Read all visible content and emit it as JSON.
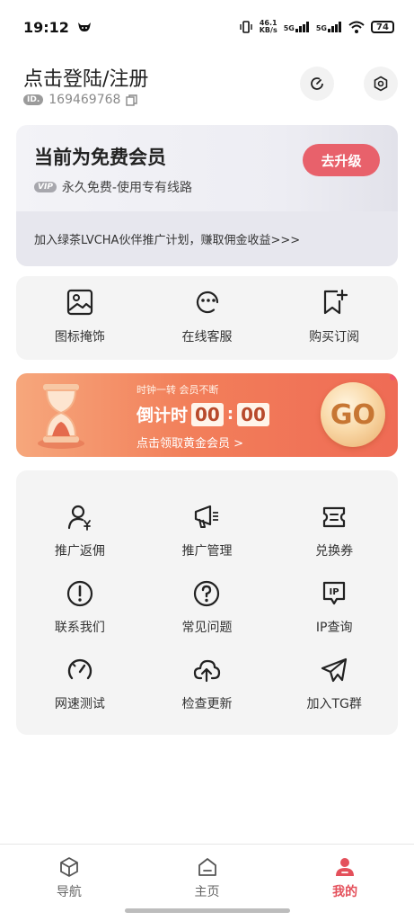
{
  "status_bar": {
    "time": "19:12",
    "net_speed_value": "46.1",
    "net_speed_unit": "KB/s",
    "sig1": "5G",
    "sig2": "5G",
    "battery": "74"
  },
  "header": {
    "login_text": "点击登陆/注册",
    "id_badge": "ID.",
    "user_id": "169469768",
    "icons": [
      "speed-test-icon",
      "settings-icon"
    ]
  },
  "membership": {
    "title": "当前为免费会员",
    "vip_tag": "VIP",
    "subtitle": "永久免费-使用专有线路",
    "upgrade_label": "去升级",
    "promo_text": "加入绿茶LVCHA伙伴推广计划，赚取佣金收益>>>"
  },
  "quick_actions": [
    {
      "label": "图标掩饰",
      "icon": "image-icon"
    },
    {
      "label": "在线客服",
      "icon": "chat-face-icon"
    },
    {
      "label": "购买订阅",
      "icon": "bookmark-plus-icon"
    }
  ],
  "banner": {
    "line1": "时钟一转 会员不断",
    "countdown_label": "倒计时",
    "minutes": "00",
    "colon": ":",
    "seconds": "00",
    "cta": "点击领取黄金会员 >",
    "go_label": "GO"
  },
  "grid": [
    {
      "label": "推广返佣",
      "icon": "user-yen-icon"
    },
    {
      "label": "推广管理",
      "icon": "megaphone-icon"
    },
    {
      "label": "兑换券",
      "icon": "coupon-icon"
    },
    {
      "label": "联系我们",
      "icon": "alert-circle-icon"
    },
    {
      "label": "常见问题",
      "icon": "question-circle-icon"
    },
    {
      "label": "IP查询",
      "icon": "ip-icon"
    },
    {
      "label": "网速测试",
      "icon": "speedometer-icon"
    },
    {
      "label": "检查更新",
      "icon": "cloud-upload-icon"
    },
    {
      "label": "加入TG群",
      "icon": "telegram-icon"
    }
  ],
  "ip_icon_text": "IP",
  "bottom_nav": [
    {
      "label": "导航",
      "icon": "cube-icon",
      "active": false
    },
    {
      "label": "主页",
      "icon": "home-icon",
      "active": false
    },
    {
      "label": "我的",
      "icon": "profile-icon",
      "active": true
    }
  ],
  "colors": {
    "accent": "#e4505b",
    "upgrade_button": "#e8616b",
    "banner_start": "#f6a77c",
    "banner_end": "#ef6b55"
  }
}
